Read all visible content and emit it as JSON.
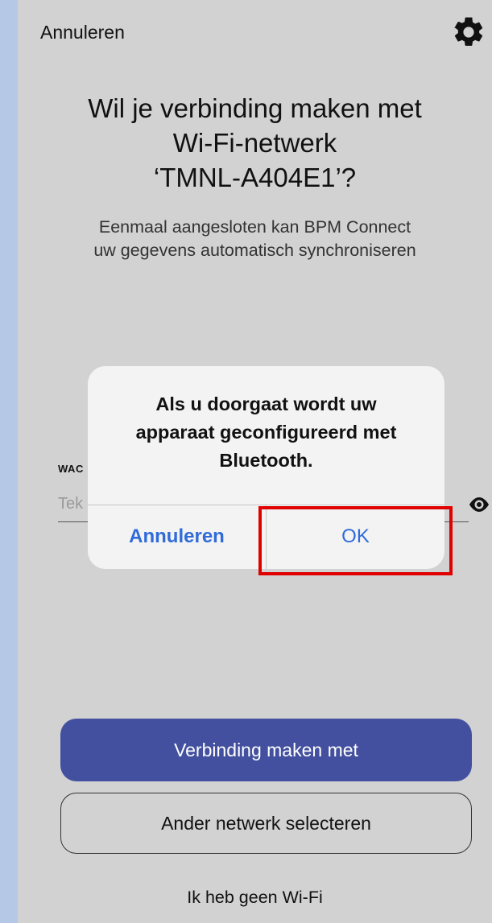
{
  "header": {
    "cancel_label": "Annuleren",
    "settings_icon": "gear-icon"
  },
  "main": {
    "title_line1": "Wil je verbinding maken met",
    "title_line2": "Wi-Fi-netwerk",
    "title_line3": "‘TMNL-A404E1’?",
    "subtitle_line1": "Eenmaal aangesloten kan BPM Connect",
    "subtitle_line2": "uw gegevens automatisch synchroniseren"
  },
  "password_field": {
    "label": "WAC",
    "placeholder": "Tek",
    "visibility_icon": "eye-icon"
  },
  "dialog": {
    "message_line1": "Als u doorgaat wordt uw",
    "message_line2": "apparaat geconfigureerd met",
    "message_line3": "Bluetooth.",
    "cancel_label": "Annuleren",
    "ok_label": "OK"
  },
  "actions": {
    "connect_label": "Verbinding maken met",
    "other_network_label": "Ander netwerk selecteren",
    "no_wifi_label": "Ik heb geen Wi-Fi"
  },
  "colors": {
    "primary_button": "#43509f",
    "dialog_action": "#2f6bd9",
    "highlight": "#e00000",
    "screen_background": "#d2d2d2"
  }
}
